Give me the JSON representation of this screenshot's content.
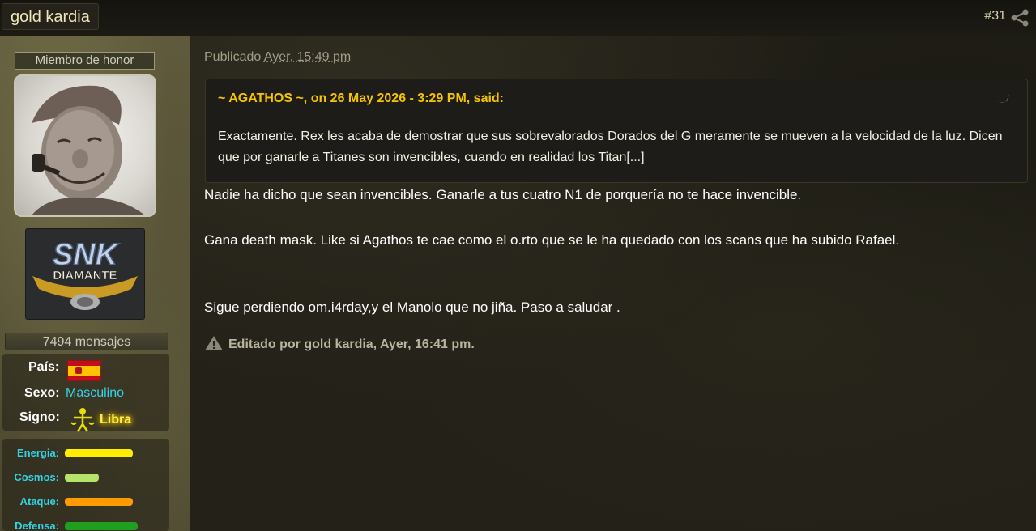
{
  "header": {
    "author": "gold kardia",
    "post_number": "#31",
    "share_icon": "share-icon"
  },
  "sidebar": {
    "rank": "Miembro de honor",
    "logo_text_top": "SNK",
    "logo_text_bottom": "DIAMANTE",
    "posts_count": "7494 mensajes",
    "info": {
      "country_label": "País:",
      "sex_label": "Sexo:",
      "sex_value": "Masculino",
      "sign_label": "Signo:",
      "sign_value": "Libra"
    },
    "stats": [
      {
        "label": "Energia:",
        "color": "#ffee00",
        "level": 0.7
      },
      {
        "label": "Cosmos:",
        "color": "#b6e36a",
        "level": 0.35
      },
      {
        "label": "Ataque:",
        "color": "#ff9a00",
        "level": 0.7
      },
      {
        "label": "Defensa:",
        "color": "#1f9e1f",
        "level": 0.75
      }
    ]
  },
  "post": {
    "posted_prefix": "Publicado",
    "posted_time": "Ayer, 15:49 pm",
    "quote": {
      "citation": "~ AGATHOS ~, on 26 May 2026 - 3:29 PM, said:",
      "text": "Exactamente. Rex les acaba de demostrar que sus sobrevalorados Dorados del G meramente se mueven a la velocidad de la luz. Dicen que por ganarle a Titanes son invencibles, cuando en realidad los Titan[...]"
    },
    "lines": [
      "Nadie ha dicho que sean invencibles. Ganarle a tus cuatro N1 de porquería no te hace invencible.",
      "Gana death mask. Like si Agathos te cae como el o.rto que se le ha quedado con los scans que ha subido Rafael.",
      "Sigue perdiendo om.i4rday,y el Manolo que no jiña. Paso a saludar ."
    ],
    "edit_note": "Editado por gold kardia, Ayer, 16:41 pm."
  }
}
